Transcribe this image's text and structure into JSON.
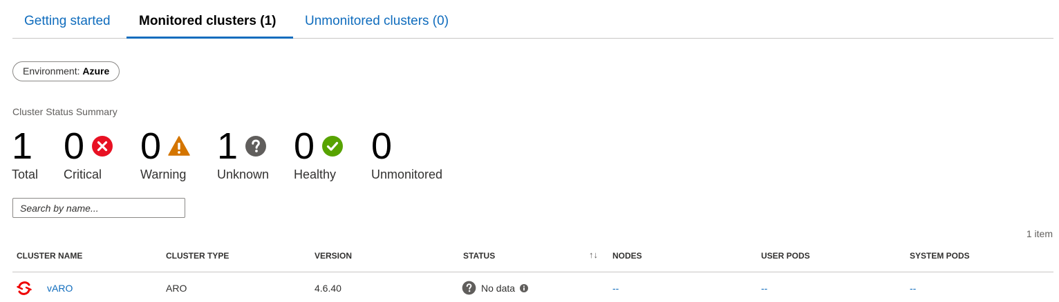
{
  "tabs": [
    {
      "label": "Getting started"
    },
    {
      "label": "Monitored clusters (1)"
    },
    {
      "label": "Unmonitored clusters (0)"
    }
  ],
  "filter": {
    "prefix": "Environment: ",
    "value": "Azure"
  },
  "summary": {
    "title": "Cluster Status Summary",
    "stats": [
      {
        "value": "1",
        "label": "Total"
      },
      {
        "value": "0",
        "label": "Critical",
        "icon": "critical-icon"
      },
      {
        "value": "0",
        "label": "Warning",
        "icon": "warning-icon"
      },
      {
        "value": "1",
        "label": "Unknown",
        "icon": "unknown-icon"
      },
      {
        "value": "0",
        "label": "Healthy",
        "icon": "healthy-icon"
      },
      {
        "value": "0",
        "label": "Unmonitored"
      }
    ]
  },
  "search": {
    "placeholder": "Search by name..."
  },
  "table": {
    "count": "1 item",
    "columns": [
      "CLUSTER NAME",
      "CLUSTER TYPE",
      "VERSION",
      "STATUS",
      "NODES",
      "USER PODS",
      "SYSTEM PODS"
    ],
    "rows": [
      {
        "name": "vARO",
        "type": "ARO",
        "version": "4.6.40",
        "status": "No data",
        "nodes": "--",
        "user_pods": "--",
        "system_pods": "--"
      }
    ]
  },
  "colors": {
    "accent": "#0f6cbd",
    "critical": "#e81123",
    "warning": "#d47500",
    "unknown": "#605e5c",
    "healthy": "#57a300",
    "openshift": "#e00"
  }
}
